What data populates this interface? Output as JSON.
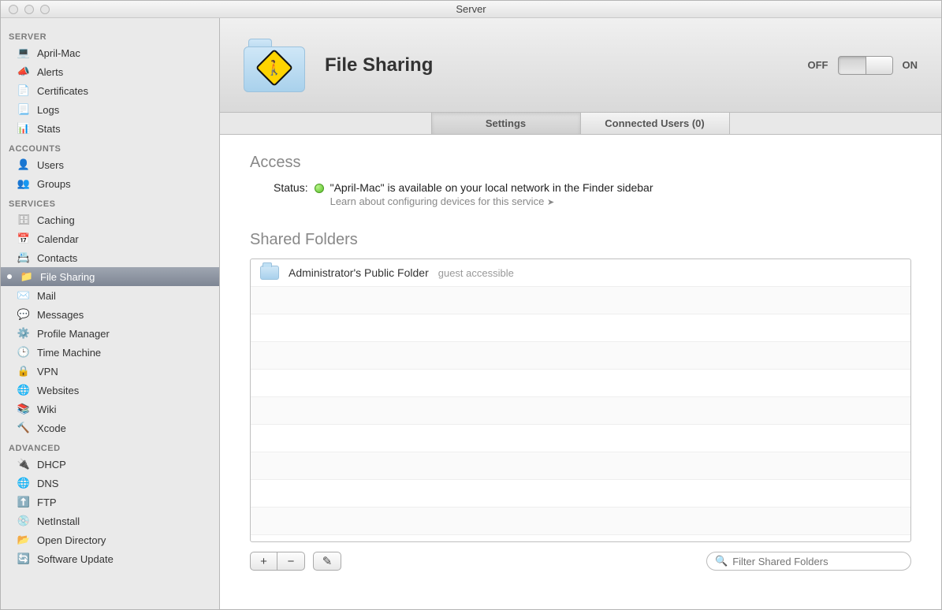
{
  "window": {
    "title": "Server"
  },
  "sidebar": {
    "groups": [
      {
        "label": "SERVER",
        "items": [
          {
            "label": "April-Mac",
            "icon": "laptop-icon"
          },
          {
            "label": "Alerts",
            "icon": "megaphone-icon"
          },
          {
            "label": "Certificates",
            "icon": "certificate-icon"
          },
          {
            "label": "Logs",
            "icon": "log-icon"
          },
          {
            "label": "Stats",
            "icon": "stats-icon"
          }
        ]
      },
      {
        "label": "ACCOUNTS",
        "items": [
          {
            "label": "Users",
            "icon": "user-icon"
          },
          {
            "label": "Groups",
            "icon": "group-icon"
          }
        ]
      },
      {
        "label": "SERVICES",
        "items": [
          {
            "label": "Caching",
            "icon": "caching-icon"
          },
          {
            "label": "Calendar",
            "icon": "calendar-icon"
          },
          {
            "label": "Contacts",
            "icon": "contacts-icon"
          },
          {
            "label": "File Sharing",
            "icon": "folder-icon",
            "selected": true,
            "statusDot": true
          },
          {
            "label": "Mail",
            "icon": "mail-icon"
          },
          {
            "label": "Messages",
            "icon": "messages-icon"
          },
          {
            "label": "Profile Manager",
            "icon": "profile-icon"
          },
          {
            "label": "Time Machine",
            "icon": "timemachine-icon"
          },
          {
            "label": "VPN",
            "icon": "lock-icon"
          },
          {
            "label": "Websites",
            "icon": "globe-icon"
          },
          {
            "label": "Wiki",
            "icon": "wiki-icon"
          },
          {
            "label": "Xcode",
            "icon": "hammer-icon"
          }
        ]
      },
      {
        "label": "ADVANCED",
        "items": [
          {
            "label": "DHCP",
            "icon": "dhcp-icon"
          },
          {
            "label": "DNS",
            "icon": "globe-icon"
          },
          {
            "label": "FTP",
            "icon": "ftp-icon"
          },
          {
            "label": "NetInstall",
            "icon": "netinstall-icon"
          },
          {
            "label": "Open Directory",
            "icon": "directory-icon"
          },
          {
            "label": "Software Update",
            "icon": "update-icon"
          }
        ]
      }
    ]
  },
  "header": {
    "title": "File Sharing",
    "offLabel": "OFF",
    "onLabel": "ON",
    "switchState": "on"
  },
  "tabs": {
    "settings": "Settings",
    "connected": "Connected Users (0)",
    "active": "settings"
  },
  "access": {
    "heading": "Access",
    "statusLabel": "Status:",
    "statusText": "\"April-Mac\" is available on your local network in the Finder sidebar",
    "learn": "Learn about configuring devices for this service"
  },
  "shared": {
    "heading": "Shared Folders",
    "rows": [
      {
        "name": "Administrator's Public Folder",
        "meta": "guest accessible"
      }
    ],
    "emptyRows": 9
  },
  "toolbar": {
    "add": "+",
    "remove": "−",
    "edit": "✎",
    "searchPlaceholder": "Filter Shared Folders"
  }
}
